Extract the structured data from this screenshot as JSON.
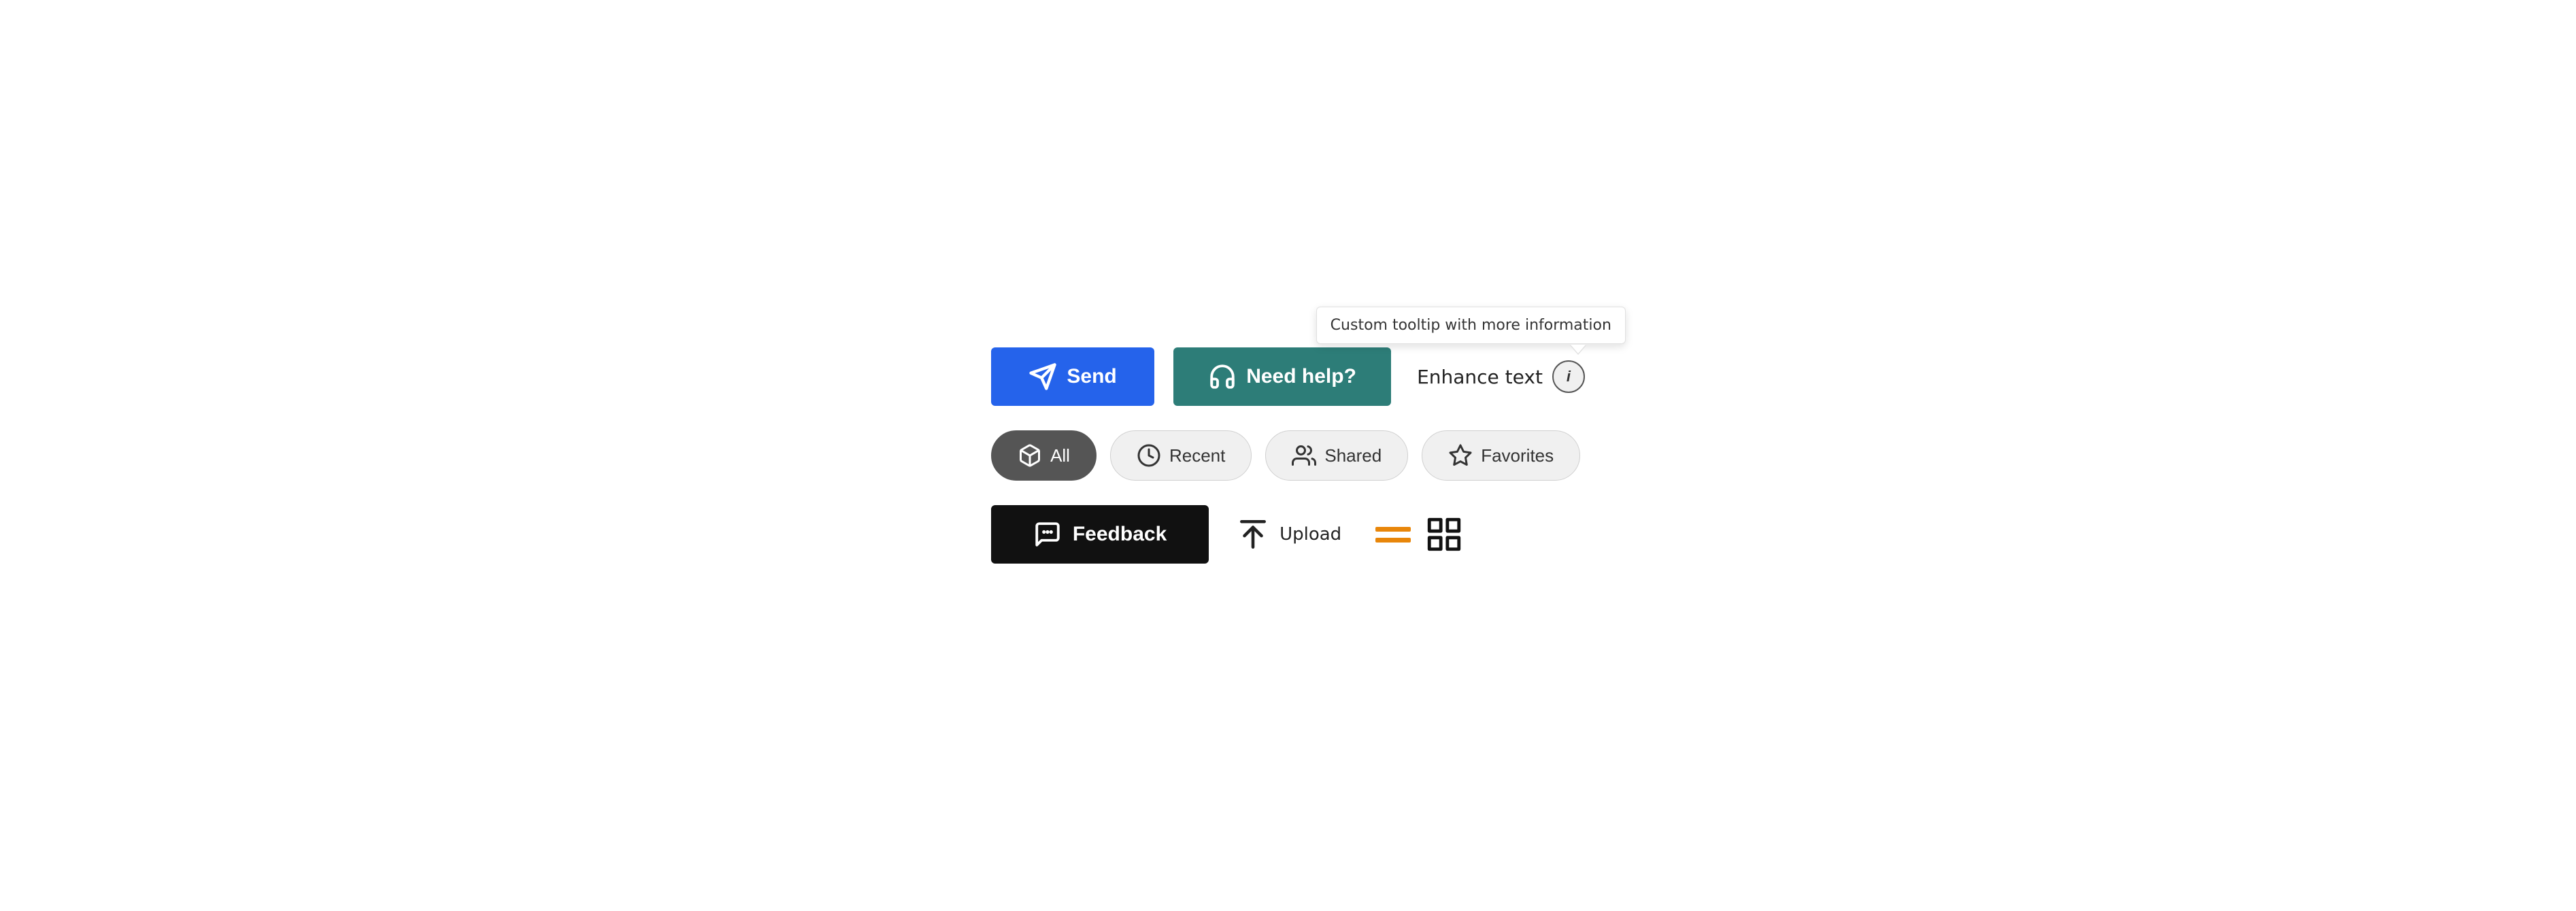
{
  "tooltip": {
    "text": "Custom tooltip with more information"
  },
  "row1": {
    "send_label": "Send",
    "help_label": "Need help?",
    "enhance_label": "Enhance text",
    "info_label": "i"
  },
  "row2": {
    "filters": [
      {
        "id": "all",
        "label": "All",
        "active": true
      },
      {
        "id": "recent",
        "label": "Recent",
        "active": false
      },
      {
        "id": "shared",
        "label": "Shared",
        "active": false
      },
      {
        "id": "favorites",
        "label": "Favorites",
        "active": false
      }
    ]
  },
  "row3": {
    "feedback_label": "Feedback",
    "upload_label": "Upload"
  }
}
